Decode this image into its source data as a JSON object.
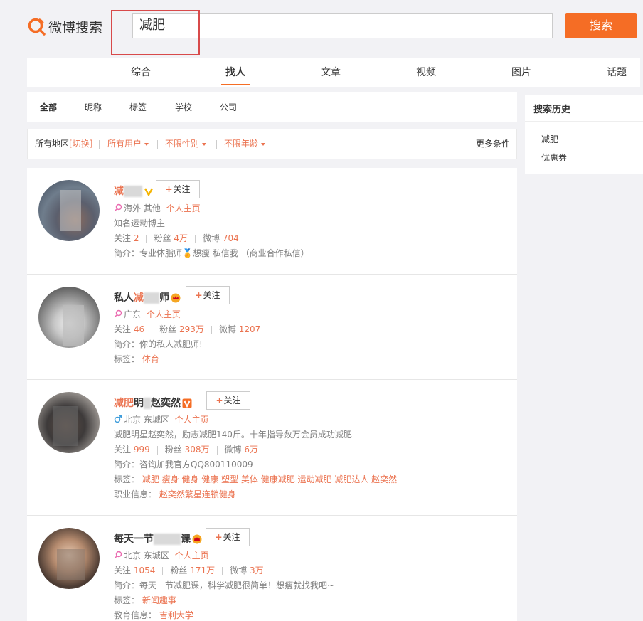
{
  "header": {
    "logo_text": "微博搜索",
    "search_value": "减肥",
    "search_button": "搜索",
    "accent_color": "#f56d25"
  },
  "main_tabs": [
    {
      "label": "综合",
      "active": false
    },
    {
      "label": "找人",
      "active": true
    },
    {
      "label": "文章",
      "active": false
    },
    {
      "label": "视频",
      "active": false
    },
    {
      "label": "图片",
      "active": false
    },
    {
      "label": "话题",
      "active": false
    }
  ],
  "sub_tabs": [
    {
      "label": "全部",
      "active": true
    },
    {
      "label": "昵称",
      "active": false
    },
    {
      "label": "标签",
      "active": false
    },
    {
      "label": "学校",
      "active": false
    },
    {
      "label": "公司",
      "active": false
    }
  ],
  "filters": {
    "region": "所有地区",
    "region_switch": "[切换]",
    "user_type": "所有用户",
    "gender": "不限性别",
    "age": "不限年龄",
    "more": "更多条件"
  },
  "sidebar": {
    "title": "搜索历史",
    "history": [
      "减肥",
      "优惠券"
    ]
  },
  "results": [
    {
      "name_parts": [
        "减"
      ],
      "badge": "yellow-v",
      "follow_label": "关注",
      "location": "海外 其他",
      "homepage": "个人主页",
      "gender_icon": "female",
      "description": "知名运动博主",
      "follow_count_label": "关注",
      "follow_count": "2",
      "fans_label": "粉丝",
      "fans": "4万",
      "weibo_label": "微博",
      "weibo": "704",
      "intro_label": "简介：",
      "intro": "专业体脂师🏅想瘦 私信我 （商业合作私信）"
    },
    {
      "name_prefix": "私人",
      "name_hl": "减",
      "name_suffix": "师",
      "badge": "crown",
      "follow_label": "关注",
      "location": "广东",
      "homepage": "个人主页",
      "gender_icon": "female",
      "follow_count_label": "关注",
      "follow_count": "46",
      "fans_label": "粉丝",
      "fans": "293万",
      "weibo_label": "微博",
      "weibo": "1207",
      "intro_label": "简介：",
      "intro": "你的私人减肥师!",
      "tags_label": "标签：",
      "tags": "体育"
    },
    {
      "name_hl": "减肥",
      "name_mid": "明",
      "name_suffix": "赵奕然",
      "badge": "orange-v",
      "follow_label": "关注",
      "location": "北京 东城区",
      "homepage": "个人主页",
      "gender_icon": "male",
      "description": "减肥明星赵奕然，励志减肥140斤。十年指导数万会员成功减肥",
      "follow_count_label": "关注",
      "follow_count": "999",
      "fans_label": "粉丝",
      "fans": "308万",
      "weibo_label": "微博",
      "weibo": "6万",
      "intro_label": "简介：",
      "intro": "咨询加我官方QQ800110009",
      "tags_label": "标签：",
      "tags": "减肥 瘦身 健身 健康 塑型 美体 健康减肥 运动减肥 减肥达人 赵奕然",
      "job_label": "职业信息：",
      "job": "赵奕然繁星连锁健身"
    },
    {
      "name_prefix": "每天一节",
      "name_suffix": "课",
      "badge": "crown",
      "follow_label": "关注",
      "location": "北京 东城区",
      "homepage": "个人主页",
      "gender_icon": "female",
      "follow_count_label": "关注",
      "follow_count": "1054",
      "fans_label": "粉丝",
      "fans": "171万",
      "weibo_label": "微博",
      "weibo": "3万",
      "intro_label": "简介：",
      "intro": "每天一节减肥课，科学减肥很简单！想瘦就找我吧~",
      "tags_label": "标签：",
      "tags": "新闻趣事",
      "edu_label": "教育信息：",
      "edu": "吉利大学"
    }
  ]
}
